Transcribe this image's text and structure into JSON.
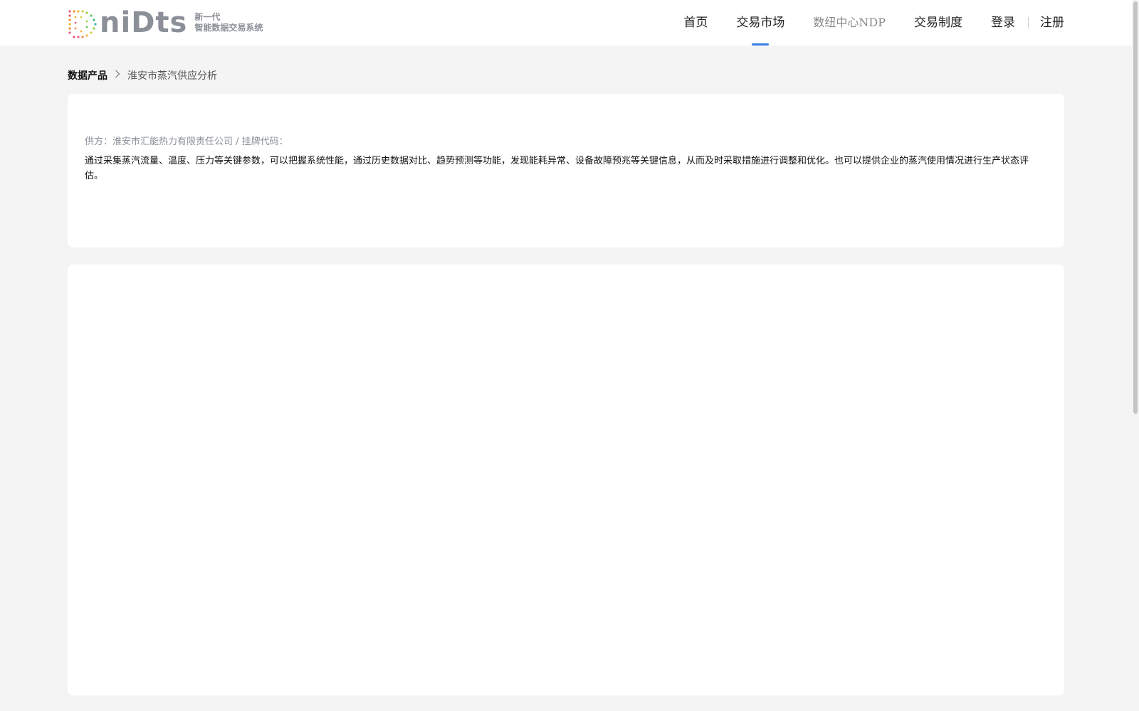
{
  "brand": {
    "wordmark_d": "D",
    "wordmark_rest": "niDts",
    "tagline_line1": "新一代",
    "tagline_line2": "智能数据交易系统"
  },
  "nav": {
    "items": [
      {
        "label": "首页",
        "active": false
      },
      {
        "label": "交易市场",
        "active": true
      },
      {
        "label": "数纽中心NDP",
        "active": false
      },
      {
        "label": "交易制度",
        "active": false
      }
    ],
    "login": "登录",
    "register": "注册",
    "accent_color": "#3a7be8"
  },
  "breadcrumb": {
    "root": "数据产品",
    "separator": ">",
    "current": "淮安市蒸汽供应分析"
  },
  "product": {
    "supplier_line": "供方：淮安市汇能热力有限责任公司 / 挂牌代码：",
    "description": "通过采集蒸汽流量、温度、压力等关键参数，可以把握系统性能，通过历史数据对比、趋势预测等功能，发现能耗异常、设备故障预兆等关键信息，从而及时采取措施进行调整和优化。也可以提供企业的蒸汽使用情况进行生产状态评估。"
  }
}
